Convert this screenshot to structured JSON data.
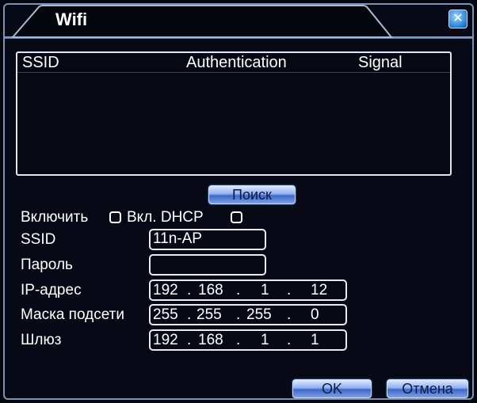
{
  "window": {
    "title": "Wifi"
  },
  "list": {
    "columns": [
      "SSID",
      "Authentication",
      "Signal"
    ],
    "rows": []
  },
  "buttons": {
    "search": "Поиск",
    "ok": "OK",
    "cancel": "Отмена"
  },
  "options": {
    "enable_label": "Включить",
    "enable_checked": false,
    "dhcp_label": "Вкл. DHCP",
    "dhcp_checked": false
  },
  "form": {
    "ssid_label": "SSID",
    "ssid_value": "11n-AP",
    "password_label": "Пароль",
    "password_value": "",
    "ip_label": "IP-адрес",
    "ip": [
      "192",
      "168",
      "1",
      "12"
    ],
    "mask_label": "Маска подсети",
    "mask": [
      "255",
      "255",
      "255",
      "0"
    ],
    "gateway_label": "Шлюз",
    "gateway": [
      "192",
      "168",
      "1",
      "1"
    ]
  },
  "icons": {
    "close": "close-icon"
  }
}
